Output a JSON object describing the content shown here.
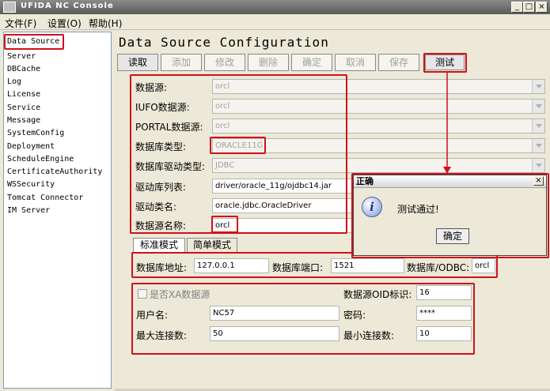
{
  "window": {
    "title": "UFIDA NC Console"
  },
  "menu": [
    "文件(F)",
    "设置(O)",
    "帮助(H)"
  ],
  "sidebar": {
    "items": [
      "Data Source",
      "Server",
      "DBCache",
      "Log",
      "License",
      "Service",
      "Message",
      "SystemConfig",
      "Deployment",
      "ScheduleEngine",
      "CertificateAuthority",
      "WSSecurity",
      "Tomcat Connector",
      "IM Server"
    ]
  },
  "main": {
    "heading": "Data Source Configuration",
    "toolbar": {
      "read": "读取",
      "add": "添加",
      "edit": "修改",
      "delete": "删除",
      "confirm": "确定",
      "cancel": "取消",
      "save": "保存",
      "test": "测试"
    },
    "form": {
      "datasource": {
        "label": "数据源:",
        "value": "orcl"
      },
      "iufo": {
        "label": "IUFO数据源:",
        "value": "orcl"
      },
      "portal": {
        "label": "PORTAL数据源:",
        "value": "orcl"
      },
      "dbtype": {
        "label": "数据库类型:",
        "value": "ORACLE11G"
      },
      "drivertype": {
        "label": "数据库驱动类型:",
        "value": "JDBC"
      },
      "driverlist": {
        "label": "驱动库列表:",
        "value": "driver/oracle_11g/ojdbc14.jar"
      },
      "driverclass": {
        "label": "驱动类名:",
        "value": "oracle.jdbc.OracleDriver"
      },
      "dsname": {
        "label": "数据源名称:",
        "value": "orcl"
      }
    },
    "tabs": {
      "standard": "标准模式",
      "simple": "简单模式"
    },
    "conn": {
      "host_label": "数据库地址:",
      "host": "127.0.0.1",
      "port_label": "数据库端口:",
      "port": "1521",
      "db_label": "数据库/ODBC:",
      "db": "orcl"
    },
    "pool": {
      "xa_label": "是否XA数据源",
      "oid_label": "数据源OID标识:",
      "oid": "16",
      "user_label": "用户名:",
      "user": "NC57",
      "pwd_label": "密码:",
      "pwd": "****",
      "max_label": "最大连接数:",
      "max": "50",
      "min_label": "最小连接数:",
      "min": "10"
    }
  },
  "dialog": {
    "title": "正确",
    "message": "测试通过!",
    "ok": "确定"
  },
  "colors": {
    "highlight": "#d0101a",
    "window": "#ece9d8"
  }
}
